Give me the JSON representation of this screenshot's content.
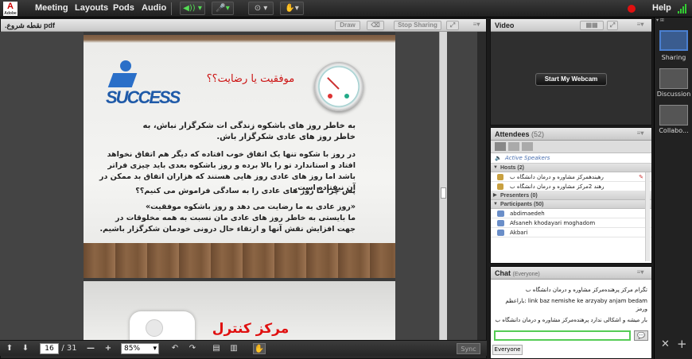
{
  "app": {
    "logo_text": "A",
    "logo_sub": "Adobe"
  },
  "menu": {
    "meeting": "Meeting",
    "layouts": "Layouts",
    "pods": "Pods",
    "audio": "Audio",
    "help": "Help"
  },
  "share_pod": {
    "title": ".نقطه شروع pdf",
    "draw_label": "Draw",
    "stop_sharing_label": "Stop Sharing",
    "slide1": {
      "heading": "موفقیت یا رضایت؟؟",
      "logo_text": "SUCCESS",
      "p1": "به خاطر روز های باشکوه زندگی ات شکرگزار نباش، به خاطر روز های عادی شکرگزار باش.",
      "p2": "در روز با شکوه تنها یک اتفاق خوب افتاده که دیگر هم اتفاق نخواهد افتاد و استاندارد تو را بالا برده و روز باشکوه بعدی باید چیزی فراتر باشد اما روز های عادی روز هایی هستند که هزاران اتفاق بد ممکن در آن نیفتاده است.",
      "p3": "پس چرا ما روز های عادی را به سادگی فراموش می کنیم؟؟",
      "p4": "«روز عادی به ما رضایت می دهد و روز باشکوه موفقیت»",
      "p5": "ما بایستی به خاطر روز های عادی مان نسبت به همه مخلوقات در جهت افزایش نقش آنها و ارتقاء حال درونی خودمان شکرگزار باشیم."
    },
    "slide2": {
      "heading": "مرکز کنترل"
    },
    "page_current": "16",
    "page_total": "/ 31",
    "zoom": "85%",
    "sync_label": "Sync"
  },
  "video_pod": {
    "title": "Video",
    "start_webcam_label": "Start My Webcam"
  },
  "attendees_pod": {
    "title": "Attendees",
    "count": "(52)",
    "active_speakers_label": "Active Speakers",
    "hosts_label": "Hosts (2)",
    "hosts": [
      "رهیندهمرکز مشاوره و درمان دانشگاه ب",
      "رهند 2مرکز مشاوره و درمان دانشگاه ب"
    ],
    "presenters_label": "Presenters (0)",
    "participants_label": "Participants (50)",
    "participants": [
      "abdimaedeh",
      "Afsaneh khodayari moghadom",
      "Akbari"
    ]
  },
  "chat_pod": {
    "title": "Chat",
    "scope": "(Everyone)",
    "messages": [
      "تگرام مرکز پرهنده‌مرکز مشاوره و درمان دانشگاه ب",
      "link baz nemishe ke arzyaby anjam bedam :باراعظم ورمز",
      "بار میشه و اشکالی ندارد پرهنده‌مرکز مشاوره و درمان دانشگاه ب"
    ],
    "tab_label": "Everyone"
  },
  "layouts_panel": {
    "items": [
      "Sharing",
      "Discussion",
      "Collabo..."
    ]
  },
  "colors": {
    "accent_green": "#33cc33",
    "heading_red": "#cc1111",
    "record_red": "#e01010",
    "selected_blue": "#4a7fd0"
  }
}
